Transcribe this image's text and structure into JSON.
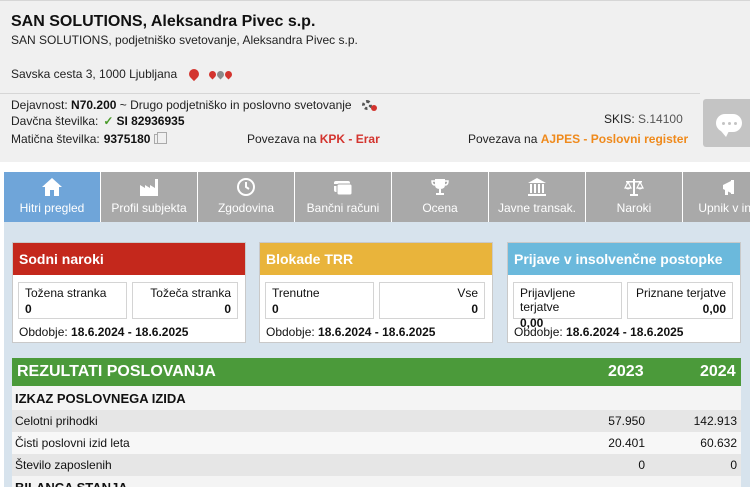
{
  "company": {
    "name": "SAN SOLUTIONS, Aleksandra Pivec s.p.",
    "full_name": "SAN SOLUTIONS, podjetniško svetovanje, Aleksandra Pivec s.p.",
    "address": "Savska cesta 3, 1000 Ljubljana"
  },
  "details": {
    "activity_label": "Dejavnost:",
    "activity_code": "N70.200",
    "activity_desc": "~ Drugo podjetniško in poslovno svetovanje",
    "tax_label": "Davčna številka:",
    "tax_check": "✓",
    "tax_value": "SI 82936935",
    "reg_label": "Matična številka:",
    "reg_value": "9375180",
    "kpk_prefix": "Povezava na",
    "kpk_link": "KPK - Erar",
    "skis_label": "SKIS:",
    "skis_value": "S.14100",
    "ajpes_prefix": "Povezava na",
    "ajpes_link": "AJPES - Poslovni register"
  },
  "tabs": [
    {
      "label": "Hitri pregled",
      "icon": "home-icon"
    },
    {
      "label": "Profil subjekta",
      "icon": "factory-icon"
    },
    {
      "label": "Zgodovina",
      "icon": "clock-icon"
    },
    {
      "label": "Bančni računi",
      "icon": "card-icon"
    },
    {
      "label": "Ocena",
      "icon": "trophy-icon"
    },
    {
      "label": "Javne transak.",
      "icon": "building-icon"
    },
    {
      "label": "Naroki",
      "icon": "scale-icon"
    },
    {
      "label": "Upnik v inso",
      "icon": "megaphone-icon"
    }
  ],
  "cards": {
    "court": {
      "title": "Sodni naroki",
      "color": "#c4281c",
      "left_label": "Tožena stranka",
      "left_value": "0",
      "right_label": "Tožeča stranka",
      "right_value": "0",
      "period_label": "Obdobje:",
      "period_value": "18.6.2024 - 18.6.2025"
    },
    "blocks": {
      "title": "Blokade TRR",
      "color": "#e9b43b",
      "left_label": "Trenutne",
      "left_value": "0",
      "right_label": "Vse",
      "right_value": "0",
      "period_label": "Obdobje:",
      "period_value": "18.6.2024 - 18.6.2025"
    },
    "insolvency": {
      "title": "Prijave v insolvenčne postopke",
      "color": "#6bb9dc",
      "left_label": "Prijavljene terjatve",
      "left_value": "0,00",
      "right_label": "Priznane terjatve",
      "right_value": "0,00",
      "period_label": "Obdobje:",
      "period_value": "18.6.2024 - 18.6.2025"
    }
  },
  "results": {
    "title": "REZULTATI POSLOVANJA",
    "year1": "2023",
    "year2": "2024",
    "section": "IZKAZ POSLOVNEGA IZIDA",
    "rows": [
      {
        "label": "Celotni prihodki",
        "v1": "57.950",
        "v2": "142.913"
      },
      {
        "label": "Čisti poslovni izid leta",
        "v1": "20.401",
        "v2": "60.632"
      },
      {
        "label": "Število zaposlenih",
        "v1": "0",
        "v2": "0"
      }
    ],
    "next_section": "BILANCA STANJA"
  }
}
